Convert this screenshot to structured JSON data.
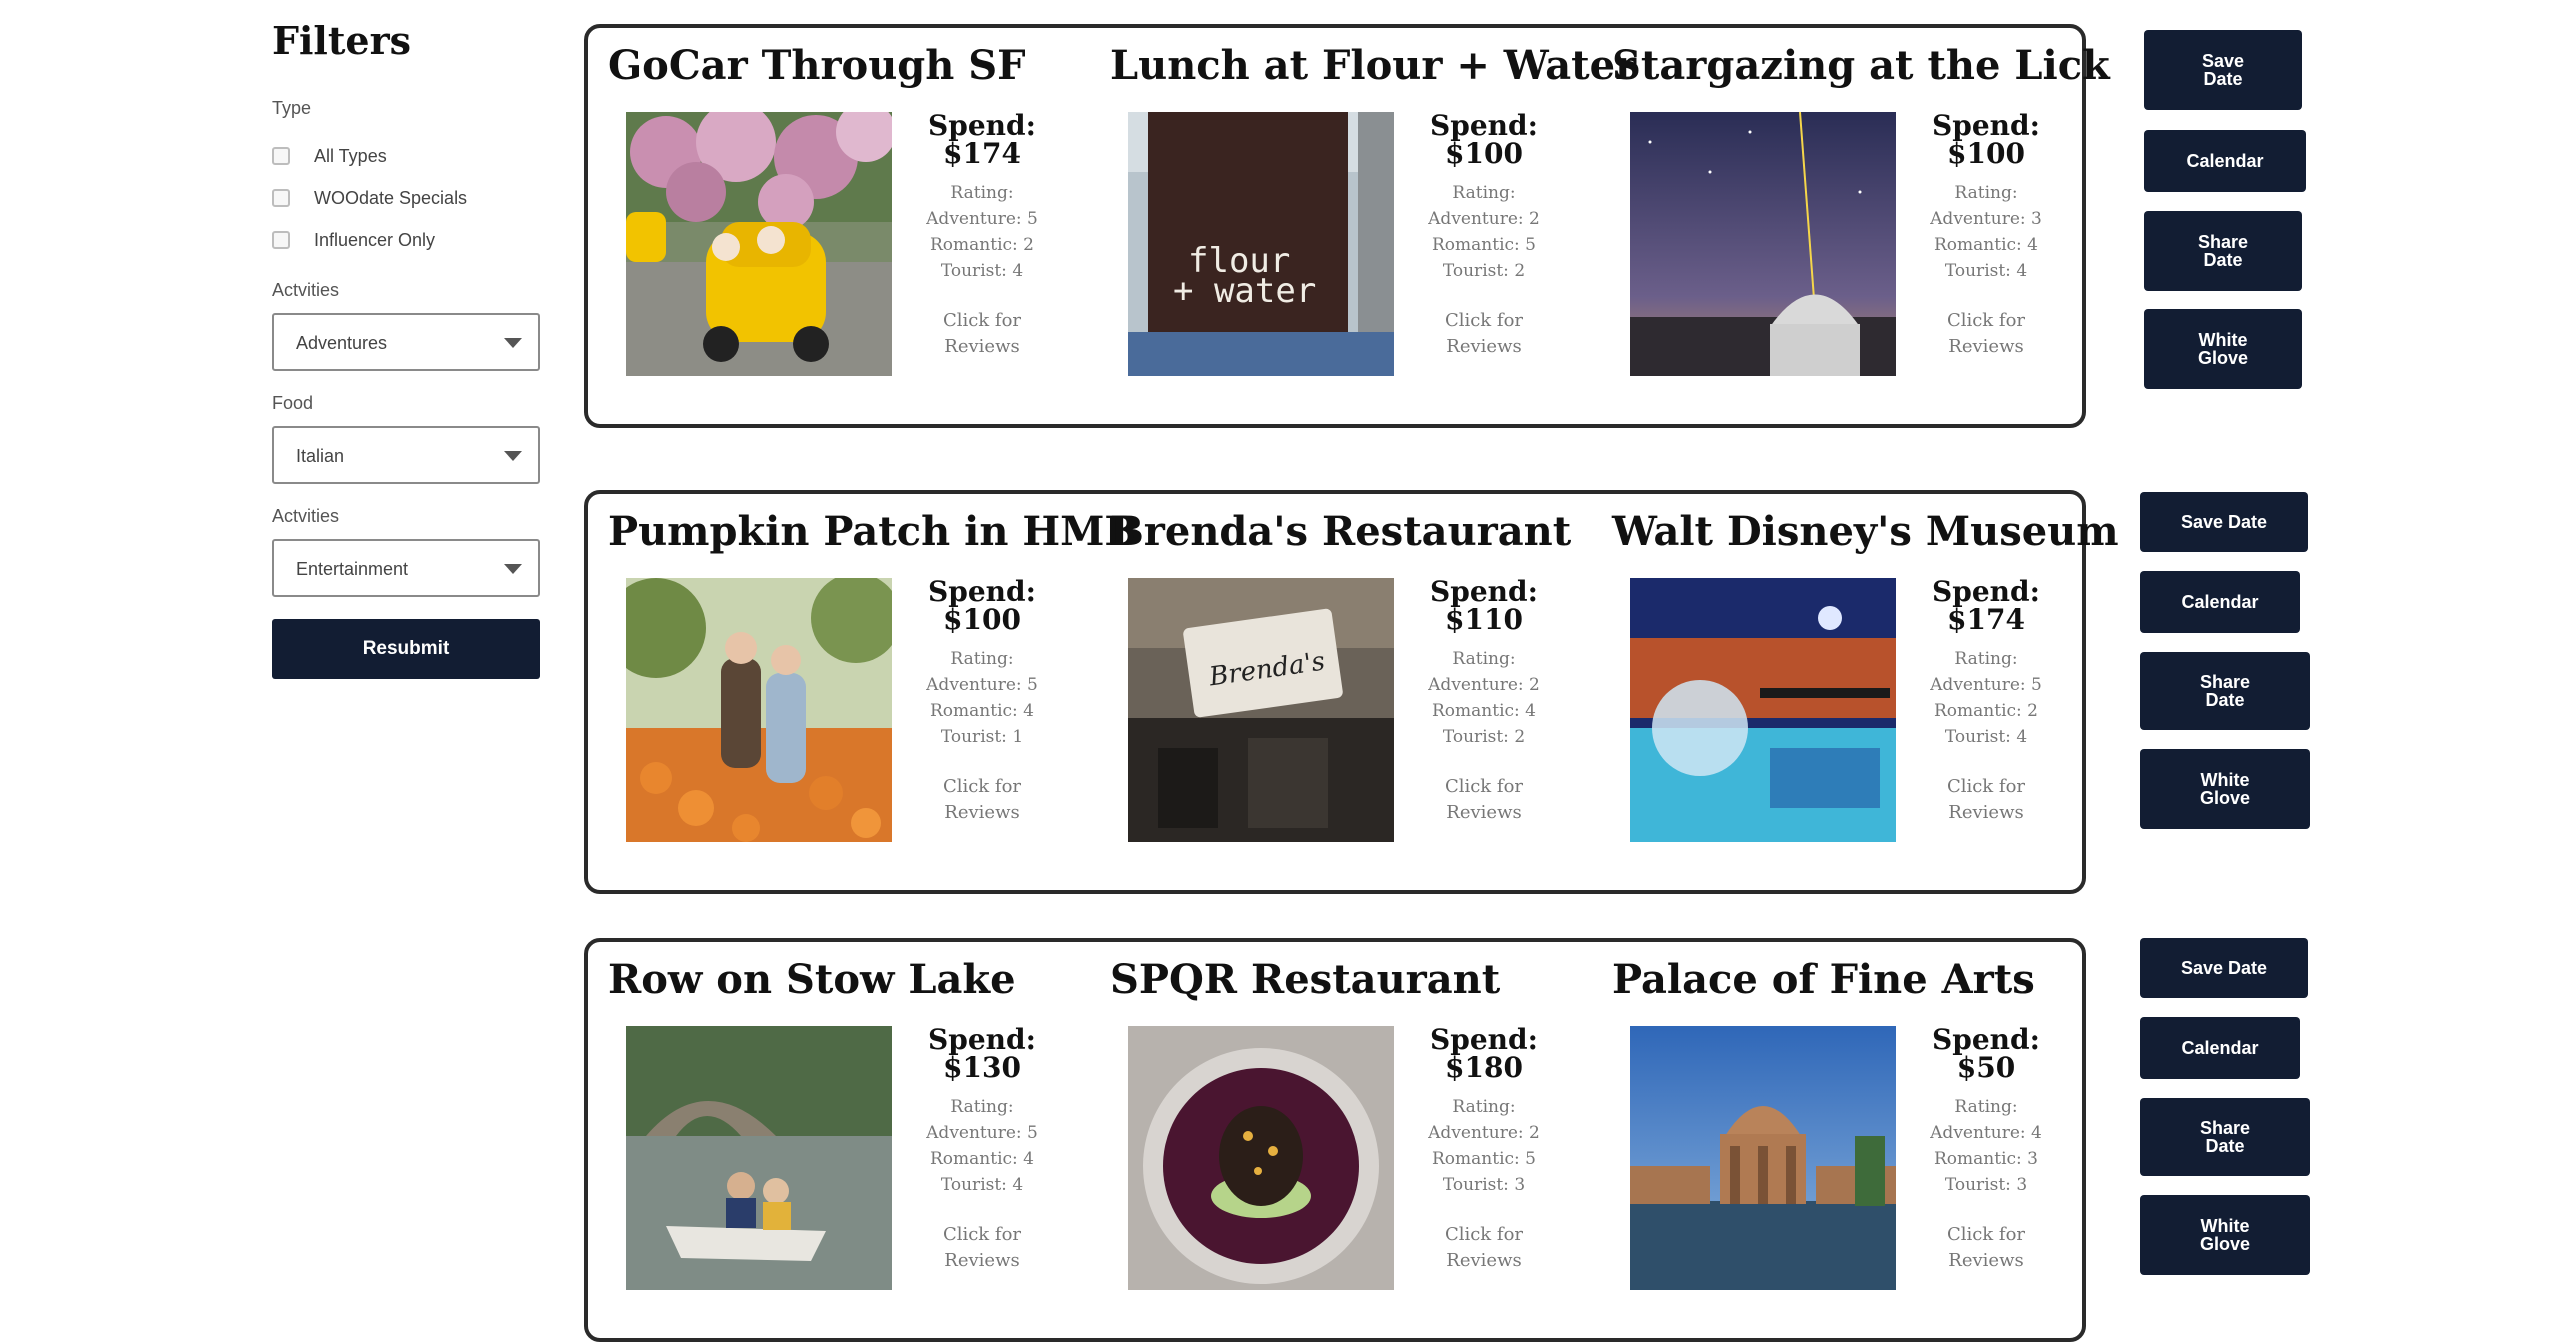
{
  "sidebar": {
    "title": "Filters",
    "type_label": "Type",
    "type_options": [
      "All Types",
      "WOOdate Specials",
      "Influencer Only"
    ],
    "activities1_label": "Actvities",
    "activities1_value": "Adventures",
    "food_label": "Food",
    "food_value": "Italian",
    "activities2_label": "Actvities",
    "activities2_value": "Entertainment",
    "resubmit_label": "Resubmit"
  },
  "groups": [
    {
      "cards": [
        {
          "title": "GoCar Through SF",
          "spend_label": "Spend:",
          "spend": "$174",
          "rating_label": "Rating:",
          "adventure": "Adventure: 5",
          "romantic": "Romantic: 2",
          "tourist": "Tourist: 4",
          "reviews_line1": "Click for",
          "reviews_line2": "Reviews",
          "image": "gocar-photo"
        },
        {
          "title": "Lunch at Flour + Water",
          "spend_label": "Spend:",
          "spend": "$100",
          "rating_label": "Rating:",
          "adventure": "Adventure: 2",
          "romantic": "Romantic: 5",
          "tourist": "Tourist: 2",
          "reviews_line1": "Click for",
          "reviews_line2": "Reviews",
          "image": "flour-water-sign-photo",
          "sign_text_1": "flour",
          "sign_text_2": "+ water"
        },
        {
          "title": "Stargazing at the Lick",
          "spend_label": "Spend:",
          "spend": "$100",
          "rating_label": "Rating:",
          "adventure": "Adventure: 3",
          "romantic": "Romantic: 4",
          "tourist": "Tourist: 4",
          "reviews_line1": "Click for",
          "reviews_line2": "Reviews",
          "image": "observatory-photo"
        }
      ],
      "actions": [
        "Save Date",
        "Calendar",
        "Share Date",
        "White Glove"
      ]
    },
    {
      "cards": [
        {
          "title": "Pumpkin Patch in HMB",
          "spend_label": "Spend:",
          "spend": "$100",
          "rating_label": "Rating:",
          "adventure": "Adventure: 5",
          "romantic": "Romantic: 4",
          "tourist": "Tourist: 1",
          "reviews_line1": "Click for",
          "reviews_line2": "Reviews",
          "image": "pumpkin-patch-photo"
        },
        {
          "title": "Brenda's Restaurant",
          "spend_label": "Spend:",
          "spend": "$110",
          "rating_label": "Rating:",
          "adventure": "Adventure: 2",
          "romantic": "Romantic: 4",
          "tourist": "Tourist: 2",
          "reviews_line1": "Click for",
          "reviews_line2": "Reviews",
          "image": "brendas-storefront-photo",
          "sign_text_1": "Brenda's"
        },
        {
          "title": "Walt Disney's Museum",
          "spend_label": "Spend:",
          "spend": "$174",
          "rating_label": "Rating:",
          "adventure": "Adventure: 5",
          "romantic": "Romantic: 2",
          "tourist": "Tourist: 4",
          "reviews_line1": "Click for",
          "reviews_line2": "Reviews",
          "image": "disney-museum-photo"
        }
      ],
      "actions": [
        "Save Date",
        "Calendar",
        "Share Date",
        "White Glove"
      ]
    },
    {
      "cards": [
        {
          "title": "Row on Stow Lake",
          "spend_label": "Spend:",
          "spend": "$130",
          "rating_label": "Rating:",
          "adventure": "Adventure: 5",
          "romantic": "Romantic: 4",
          "tourist": "Tourist: 4",
          "reviews_line1": "Click for",
          "reviews_line2": "Reviews",
          "image": "stow-lake-photo"
        },
        {
          "title": "SPQR Restaurant",
          "spend_label": "Spend:",
          "spend": "$180",
          "rating_label": "Rating:",
          "adventure": "Adventure: 2",
          "romantic": "Romantic: 5",
          "tourist": "Tourist: 3",
          "reviews_line1": "Click for",
          "reviews_line2": "Reviews",
          "image": "pasta-dish-photo"
        },
        {
          "title": "Palace of Fine Arts",
          "spend_label": "Spend:",
          "spend": "$50",
          "rating_label": "Rating:",
          "adventure": "Adventure: 4",
          "romantic": "Romantic: 3",
          "tourist": "Tourist: 3",
          "reviews_line1": "Click for",
          "reviews_line2": "Reviews",
          "image": "palace-fine-arts-photo"
        }
      ],
      "actions": [
        "Save Date",
        "Calendar",
        "Share Date",
        "White Glove"
      ]
    }
  ],
  "colors": {
    "button_bg": "#121d33",
    "border": "#2a2a2a"
  }
}
